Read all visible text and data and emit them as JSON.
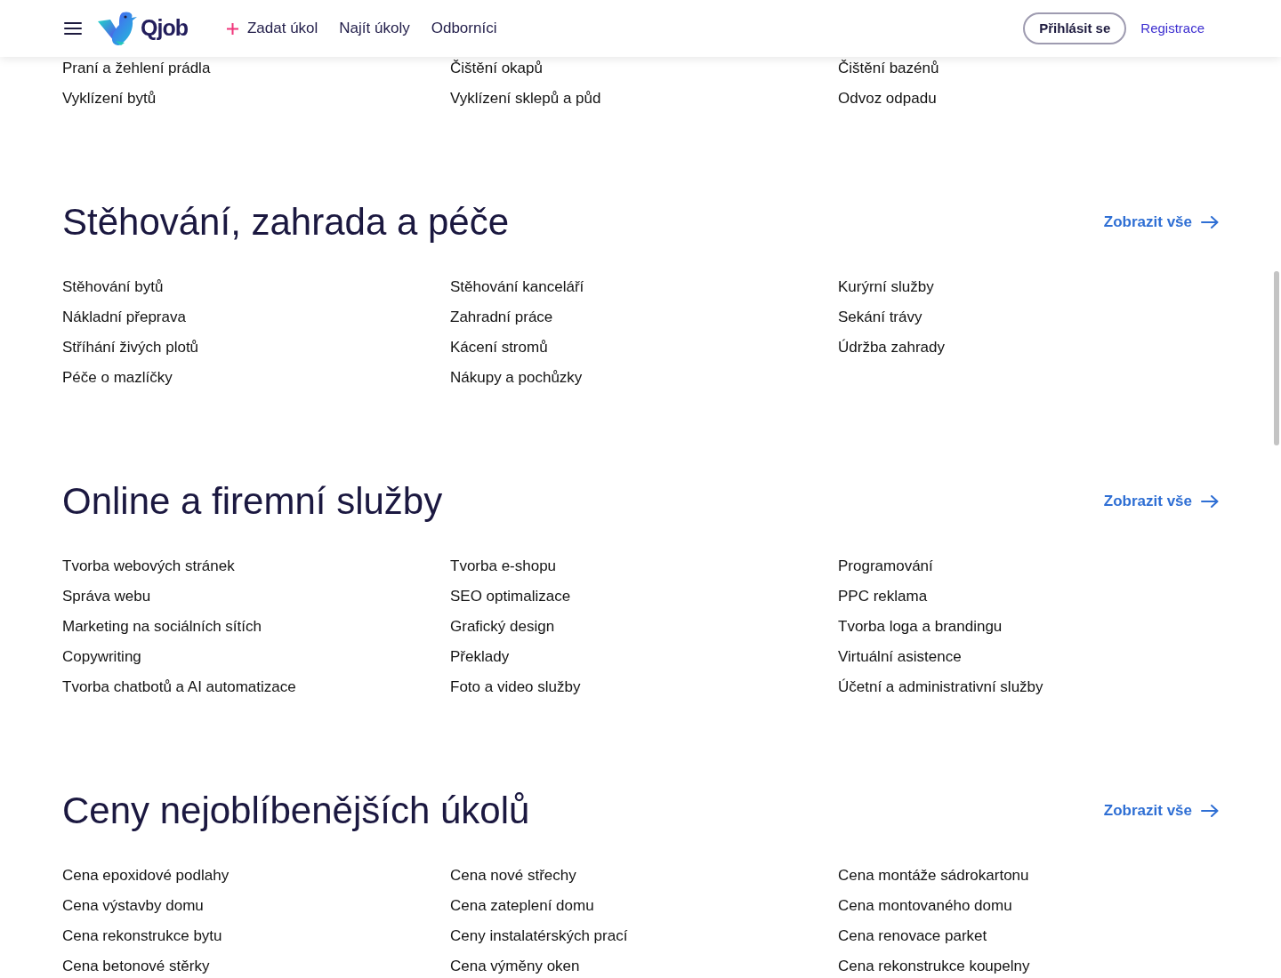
{
  "header": {
    "logo_text": "Qjob",
    "nav": [
      {
        "kind": "add",
        "label": "Zadat úkol"
      },
      {
        "kind": "link",
        "label": "Najít úkoly"
      },
      {
        "kind": "link",
        "label": "Odborníci"
      }
    ],
    "login_button": "Přihlásit se",
    "register_link": "Registrace"
  },
  "sections": [
    {
      "items": [
        "Praní a žehlení prádla",
        "Čištění okapů",
        "Čištění bazénů",
        "Vyklízení bytů",
        "Vyklízení sklepů a půd",
        "Odvoz odpadu"
      ]
    },
    {
      "title": "Stěhování, zahrada a péče",
      "show_all": "Zobrazit vše",
      "items": [
        "Stěhování bytů",
        "Stěhování kanceláří",
        "Kurýrní služby",
        "Nákladní přeprava",
        "Zahradní práce",
        "Sekání trávy",
        "Stříhání živých plotů",
        "Kácení stromů",
        "Údržba zahrady",
        "Péče o mazlíčky",
        "Nákupy a pochůzky"
      ]
    },
    {
      "title": "Online a firemní služby",
      "show_all": "Zobrazit vše",
      "items": [
        "Tvorba webových stránek",
        "Tvorba e-shopu",
        "Programování",
        "Správa webu",
        "SEO optimalizace",
        "PPC reklama",
        "Marketing na sociálních sítích",
        "Grafický design",
        "Tvorba loga a brandingu",
        "Copywriting",
        "Překlady",
        "Virtuální asistence",
        "Tvorba chatbotů a AI automatizace",
        "Foto a video služby",
        "Účetní a administrativní služby"
      ]
    },
    {
      "title": "Ceny nejoblíbenějších úkolů",
      "show_all": "Zobrazit vše",
      "items": [
        "Cena epoxidové podlahy",
        "Cena nové střechy",
        "Cena montáže sádrokartonu",
        "Cena výstavby domu",
        "Cena zateplení domu",
        "Cena montovaného domu",
        "Cena rekonstrukce bytu",
        "Ceny instalatérských prací",
        "Cena renovace parket",
        "Cena betonové stěrky",
        "Cena výměny oken",
        "Cena rekonstrukce koupelny"
      ]
    }
  ]
}
